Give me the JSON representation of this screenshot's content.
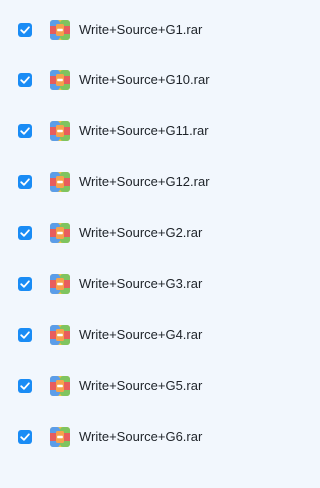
{
  "files": [
    {
      "name": "Write+Source+G1.rar",
      "checked": true,
      "icon": "rar-archive-icon"
    },
    {
      "name": "Write+Source+G10.rar",
      "checked": true,
      "icon": "rar-archive-icon"
    },
    {
      "name": "Write+Source+G11.rar",
      "checked": true,
      "icon": "rar-archive-icon"
    },
    {
      "name": "Write+Source+G12.rar",
      "checked": true,
      "icon": "rar-archive-icon"
    },
    {
      "name": "Write+Source+G2.rar",
      "checked": true,
      "icon": "rar-archive-icon"
    },
    {
      "name": "Write+Source+G3.rar",
      "checked": true,
      "icon": "rar-archive-icon"
    },
    {
      "name": "Write+Source+G4.rar",
      "checked": true,
      "icon": "rar-archive-icon"
    },
    {
      "name": "Write+Source+G5.rar",
      "checked": true,
      "icon": "rar-archive-icon"
    },
    {
      "name": "Write+Source+G6.rar",
      "checked": true,
      "icon": "rar-archive-icon"
    }
  ],
  "colors": {
    "background": "#f2f7fd",
    "checkbox": "#1a8cf5",
    "text": "#1e2329"
  }
}
